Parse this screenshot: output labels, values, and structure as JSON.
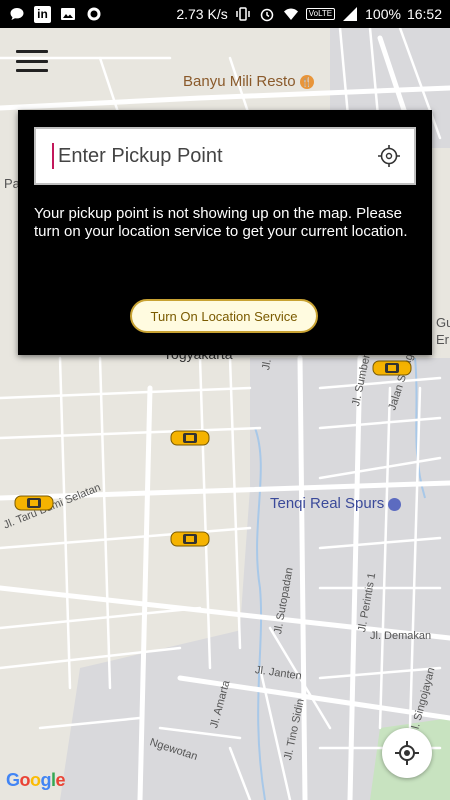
{
  "status_bar": {
    "speed": "2.73 K/s",
    "network_badge": "VoLTE",
    "battery": "100%",
    "time": "16:52",
    "left_icons": [
      "chat-bubble-icon",
      "linkedin-icon",
      "image-icon",
      "circle-app-icon"
    ],
    "right_icons": [
      "vibrate-icon",
      "alarm-icon",
      "wifi-icon",
      "signal-icon",
      "battery-icon"
    ]
  },
  "map": {
    "pois": {
      "banyu": "Banyu Mili Resto",
      "tenqi": "Tenqi Real Spurs"
    },
    "places": {
      "yogyakarta": "Yogyakarta",
      "pa": "Pa",
      "gu": "Gu",
      "er": "Er"
    },
    "streets": {
      "taru_bumi": "Jl. Taru Bumi Selatan",
      "sumberan_baru": "Jl. Sumberan Baru",
      "jalan_soragan": "Jalan Soragan",
      "sutopadan": "Jl. Sutopadan",
      "perintis": "Jl. Perintis 1",
      "demakan": "Jl. Demakan",
      "janten": "Jl. Janten",
      "amarta": "Jl. Amarta",
      "tino_sidin": "Jl. Tino Sidin",
      "singojayan": "Jl. Singojayan",
      "ngewotan": "Ngewotan",
      "jl_partial": "Jl."
    },
    "attribution": "Google"
  },
  "dialog": {
    "pickup_placeholder": "Enter Pickup Point",
    "message": "Your pickup point is not showing up on the map. Please turn on your location service to get your current location.",
    "button_label": "Turn On Location Service"
  },
  "colors": {
    "dialog_bg": "#000000",
    "button_border": "#c8a233",
    "taxi_yellow": "#f5b301",
    "cursor": "#c2185b"
  }
}
